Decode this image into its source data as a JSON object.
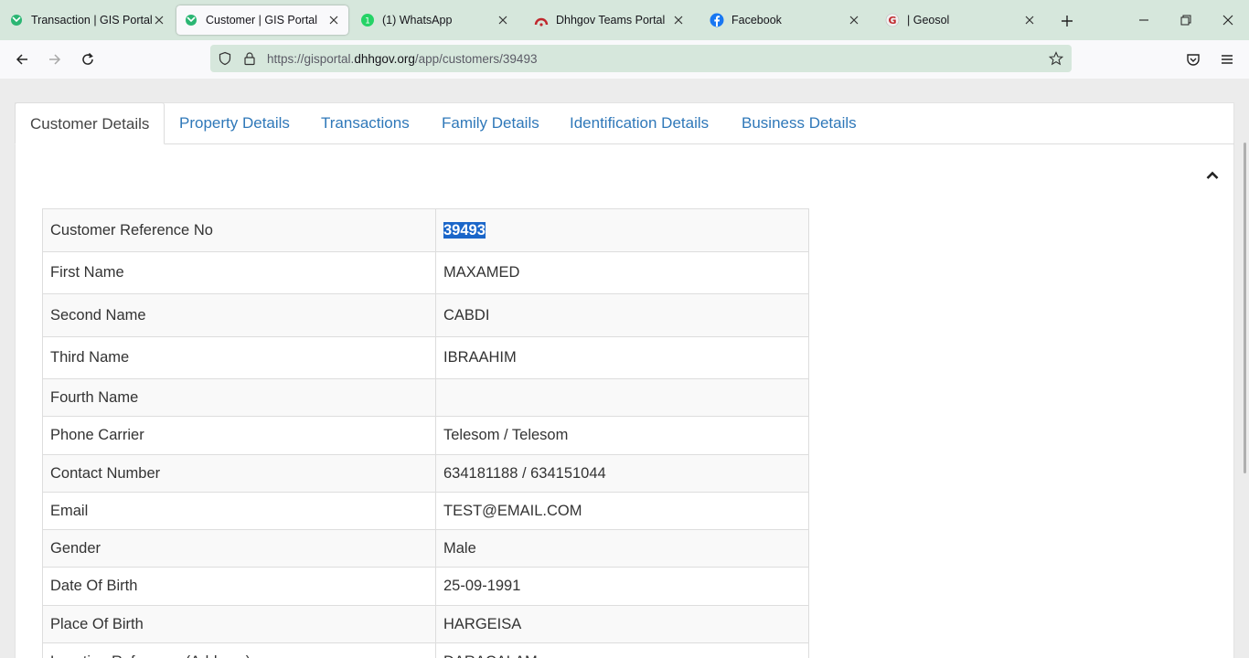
{
  "browser": {
    "tabs": [
      {
        "title": "Transaction | GIS Portal",
        "icon": "gis-portal-icon",
        "active": false
      },
      {
        "title": "Customer | GIS Portal",
        "icon": "gis-portal-icon",
        "active": true
      },
      {
        "title": "(1) WhatsApp",
        "icon": "whatsapp-icon",
        "active": false
      },
      {
        "title": "Dhhgov Teams Portal",
        "icon": "teams-portal-icon",
        "active": false
      },
      {
        "title": "Facebook",
        "icon": "facebook-icon",
        "active": false
      },
      {
        "title": "| Geosol",
        "icon": "geosol-icon",
        "active": false
      }
    ],
    "url_prefix": "https://gisportal.",
    "url_domain": "dhhgov.org",
    "url_path": "/app/customers/39493",
    "colors": {
      "chrome": "#d6e7dc",
      "toolbar": "#f9f9fb"
    }
  },
  "page": {
    "tabs": [
      {
        "label": "Customer Details",
        "active": true
      },
      {
        "label": "Property Details",
        "active": false
      },
      {
        "label": "Transactions",
        "active": false
      },
      {
        "label": "Family Details",
        "active": false
      },
      {
        "label": "Identification Details",
        "active": false
      },
      {
        "label": "Business Details",
        "active": false
      }
    ],
    "details": [
      {
        "label": "Customer Reference No",
        "value": "39493",
        "selected": true
      },
      {
        "label": "First Name",
        "value": "MAXAMED"
      },
      {
        "label": "Second Name",
        "value": "CABDI"
      },
      {
        "label": "Third Name",
        "value": "IBRAAHIM"
      },
      {
        "label": "Fourth Name",
        "value": ""
      },
      {
        "label": "Phone Carrier",
        "value": "Telesom / Telesom"
      },
      {
        "label": "Contact Number",
        "value": "634181188 / 634151044"
      },
      {
        "label": "Email",
        "value": "TEST@EMAIL.COM"
      },
      {
        "label": "Gender",
        "value": "Male"
      },
      {
        "label": "Date Of Birth",
        "value": "25-09-1991"
      },
      {
        "label": "Place Of Birth",
        "value": "HARGEISA"
      },
      {
        "label": "Location Reference (Address)",
        "value": "DARACALAM"
      }
    ],
    "colors": {
      "link": "#2f78b9",
      "selection": "#1a66c9"
    }
  }
}
